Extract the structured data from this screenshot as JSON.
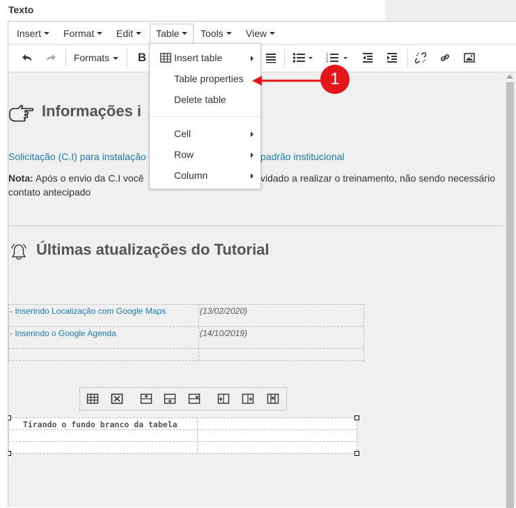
{
  "field_label": "Texto",
  "menubar": {
    "items": [
      {
        "label": "Insert"
      },
      {
        "label": "Format"
      },
      {
        "label": "Edit"
      },
      {
        "label": "Table"
      },
      {
        "label": "Tools"
      },
      {
        "label": "View"
      }
    ]
  },
  "toolbar": {
    "formats_label": "Formats",
    "bold_label": "B"
  },
  "table_menu": {
    "insert_table": "Insert table",
    "table_properties": "Table properties",
    "delete_table": "Delete table",
    "cell": "Cell",
    "row": "Row",
    "column": "Column"
  },
  "callout": {
    "number": "1",
    "color": "#e5161b"
  },
  "content": {
    "heading1": "Informações i",
    "link1_a": "Solicitação (C.I) para instalação",
    "link1_b": "padrão institucional",
    "note_label": "Nota:",
    "note_a": " Após o envio da C.I você",
    "note_b": "vidado a realizar o treinamento, não sendo necessário",
    "note_c": "contato antecipado",
    "heading2": "Últimas atualizações do Tutorial",
    "updates": [
      {
        "title": "- Inserindo Localização com Google Maps",
        "date": "(13/02/2020)"
      },
      {
        "title": "- Inserindo o Google Agenda",
        "date": "(14/10/2019)"
      }
    ],
    "table2_cell": "Tirando o fundo branco da tabela"
  },
  "colors": {
    "link": "#1a7aa9",
    "accent_red": "#e5161b"
  }
}
